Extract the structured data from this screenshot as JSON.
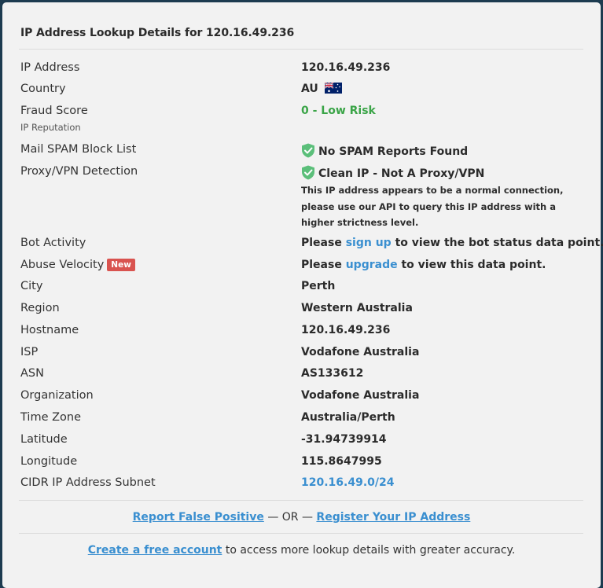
{
  "header": {
    "title": "IP Address Lookup Details for 120.16.49.236"
  },
  "rows": {
    "ip": {
      "label": "IP Address",
      "value": "120.16.49.236"
    },
    "country": {
      "label": "Country",
      "value": "AU"
    },
    "fraud": {
      "label": "Fraud Score",
      "sublabel": "IP Reputation",
      "value": "0 - Low Risk",
      "value_color": "#3aa447"
    },
    "spam": {
      "label": "Mail SPAM Block List",
      "value": "No SPAM Reports Found"
    },
    "proxy": {
      "label": "Proxy/VPN Detection",
      "value": "Clean IP - Not A Proxy/VPN",
      "note": "This IP address appears to be a normal connection, please use our API to query this IP address with a higher strictness level."
    },
    "bot": {
      "label": "Bot Activity",
      "prefix": "Please",
      "link": "sign up",
      "suffix": "to view the bot status data point."
    },
    "abuse": {
      "label": "Abuse Velocity",
      "badge": "New",
      "prefix": "Please",
      "link": "upgrade",
      "suffix": "to view this data point."
    },
    "city": {
      "label": "City",
      "value": "Perth"
    },
    "region": {
      "label": "Region",
      "value": "Western Australia"
    },
    "hostname": {
      "label": "Hostname",
      "value": "120.16.49.236"
    },
    "isp": {
      "label": "ISP",
      "value": "Vodafone Australia"
    },
    "asn": {
      "label": "ASN",
      "value": "AS133612"
    },
    "org": {
      "label": "Organization",
      "value": "Vodafone Australia"
    },
    "tz": {
      "label": "Time Zone",
      "value": "Australia/Perth"
    },
    "lat": {
      "label": "Latitude",
      "value": "-31.94739914"
    },
    "lon": {
      "label": "Longitude",
      "value": "115.8647995"
    },
    "cidr": {
      "label": "CIDR IP Address Subnet",
      "value": "120.16.49.0/24"
    }
  },
  "footer": {
    "report_link": "Report False Positive",
    "or_text": "— OR —",
    "register_link": "Register Your IP Address",
    "create_link": "Create a free account",
    "create_suffix": "to access more lookup details with greater accuracy."
  },
  "colors": {
    "background": "#1d3b50",
    "panel": "#f2f2f2",
    "green": "#3aa447",
    "link": "#3a8fd0",
    "badge": "#d9534f"
  },
  "icons": {
    "shield": "shield-check-icon",
    "flag": "australia-flag-icon"
  }
}
